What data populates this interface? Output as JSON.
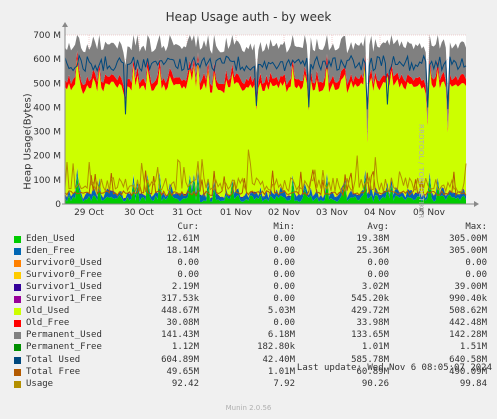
{
  "chart_data": {
    "type": "area",
    "title": "Heap Usage auth - by week",
    "ylabel": "Heap Usage(Bytes)",
    "ylim": [
      0,
      700
    ],
    "y_unit": "M",
    "y_ticks": [
      "0",
      "100 M",
      "200 M",
      "300 M",
      "400 M",
      "500 M",
      "600 M",
      "700 M"
    ],
    "x_ticks": [
      "29 Oct",
      "30 Oct",
      "31 Oct",
      "01 Nov",
      "02 Nov",
      "03 Nov",
      "04 Nov",
      "05 Nov"
    ],
    "grid": true,
    "series": [
      {
        "name": "Eden_Used",
        "color": "#00cc00",
        "cur": 12.61,
        "min": 0,
        "avg": 19.38,
        "max": 305
      },
      {
        "name": "Eden_Free",
        "color": "#0066b3",
        "cur": 18.14,
        "min": 0,
        "avg": 25.36,
        "max": 305
      },
      {
        "name": "Survivor0_Used",
        "color": "#ff8000",
        "cur": 0,
        "min": 0,
        "avg": 0,
        "max": 0
      },
      {
        "name": "Survivor0_Free",
        "color": "#ffcc00",
        "cur": 0,
        "min": 0,
        "avg": 0,
        "max": 0
      },
      {
        "name": "Survivor1_Used",
        "color": "#330099",
        "cur": 2.19,
        "min": 0,
        "avg": 3.02,
        "max": 39
      },
      {
        "name": "Survivor1_Free",
        "color": "#990099",
        "cur": 0.318,
        "min": 0,
        "avg": 0.545,
        "max": 0.99
      },
      {
        "name": "Old_Used",
        "color": "#ccff00",
        "cur": 448.67,
        "min": 5.03,
        "avg": 429.72,
        "max": 508.62
      },
      {
        "name": "Old_Free",
        "color": "#ff0000",
        "cur": 30.08,
        "min": 0,
        "avg": 33.98,
        "max": 442.48
      },
      {
        "name": "Permanent_Used",
        "color": "#808080",
        "cur": 141.43,
        "min": 6.18,
        "avg": 133.65,
        "max": 142.28
      },
      {
        "name": "Permanent_Free",
        "color": "#008f00",
        "cur": 1.12,
        "min": 0.183,
        "avg": 1.01,
        "max": 1.51
      },
      {
        "name": "Total Used",
        "color": "#00487d",
        "cur": 604.89,
        "min": 42.4,
        "avg": 585.78,
        "max": 640.58
      },
      {
        "name": "Total Free",
        "color": "#b35a00",
        "cur": 49.65,
        "min": 1.01,
        "avg": 60.89,
        "max": 490.09
      },
      {
        "name": "Usage",
        "color": "#b38f00",
        "cur": 92.42,
        "min": 7.92,
        "avg": 90.26,
        "max": 99.84
      }
    ]
  },
  "side_text": "RRDTOOL / TOBI OETIKER",
  "legend_header": {
    "cur": "Cur:",
    "min": "Min:",
    "avg": "Avg:",
    "max": "Max:"
  },
  "legend": [
    {
      "name": "Eden_Used",
      "color": "#00cc00",
      "cur": "12.61M",
      "min": "0.00",
      "avg": "19.38M",
      "max": "305.00M"
    },
    {
      "name": "Eden_Free",
      "color": "#0066b3",
      "cur": "18.14M",
      "min": "0.00",
      "avg": "25.36M",
      "max": "305.00M"
    },
    {
      "name": "Survivor0_Used",
      "color": "#ff8000",
      "cur": "0.00",
      "min": "0.00",
      "avg": "0.00",
      "max": "0.00"
    },
    {
      "name": "Survivor0_Free",
      "color": "#ffcc00",
      "cur": "0.00",
      "min": "0.00",
      "avg": "0.00",
      "max": "0.00"
    },
    {
      "name": "Survivor1_Used",
      "color": "#330099",
      "cur": "2.19M",
      "min": "0.00",
      "avg": "3.02M",
      "max": "39.00M"
    },
    {
      "name": "Survivor1_Free",
      "color": "#990099",
      "cur": "317.53k",
      "min": "0.00",
      "avg": "545.20k",
      "max": "990.40k"
    },
    {
      "name": "Old_Used",
      "color": "#ccff00",
      "cur": "448.67M",
      "min": "5.03M",
      "avg": "429.72M",
      "max": "508.62M"
    },
    {
      "name": "Old_Free",
      "color": "#ff0000",
      "cur": "30.08M",
      "min": "0.00",
      "avg": "33.98M",
      "max": "442.48M"
    },
    {
      "name": "Permanent_Used",
      "color": "#808080",
      "cur": "141.43M",
      "min": "6.18M",
      "avg": "133.65M",
      "max": "142.28M"
    },
    {
      "name": "Permanent_Free",
      "color": "#008f00",
      "cur": "1.12M",
      "min": "182.80k",
      "avg": "1.01M",
      "max": "1.51M"
    },
    {
      "name": "Total Used",
      "color": "#00487d",
      "cur": "604.89M",
      "min": "42.40M",
      "avg": "585.78M",
      "max": "640.58M"
    },
    {
      "name": "Total Free",
      "color": "#b35a00",
      "cur": "49.65M",
      "min": "1.01M",
      "avg": "60.89M",
      "max": "490.09M"
    },
    {
      "name": "Usage",
      "color": "#b38f00",
      "cur": "92.42",
      "min": "7.92",
      "avg": "90.26",
      "max": "99.84"
    }
  ],
  "last_update": "Last update: Wed Nov  6 08:05:07 2024",
  "footer": "Munin 2.0.56"
}
